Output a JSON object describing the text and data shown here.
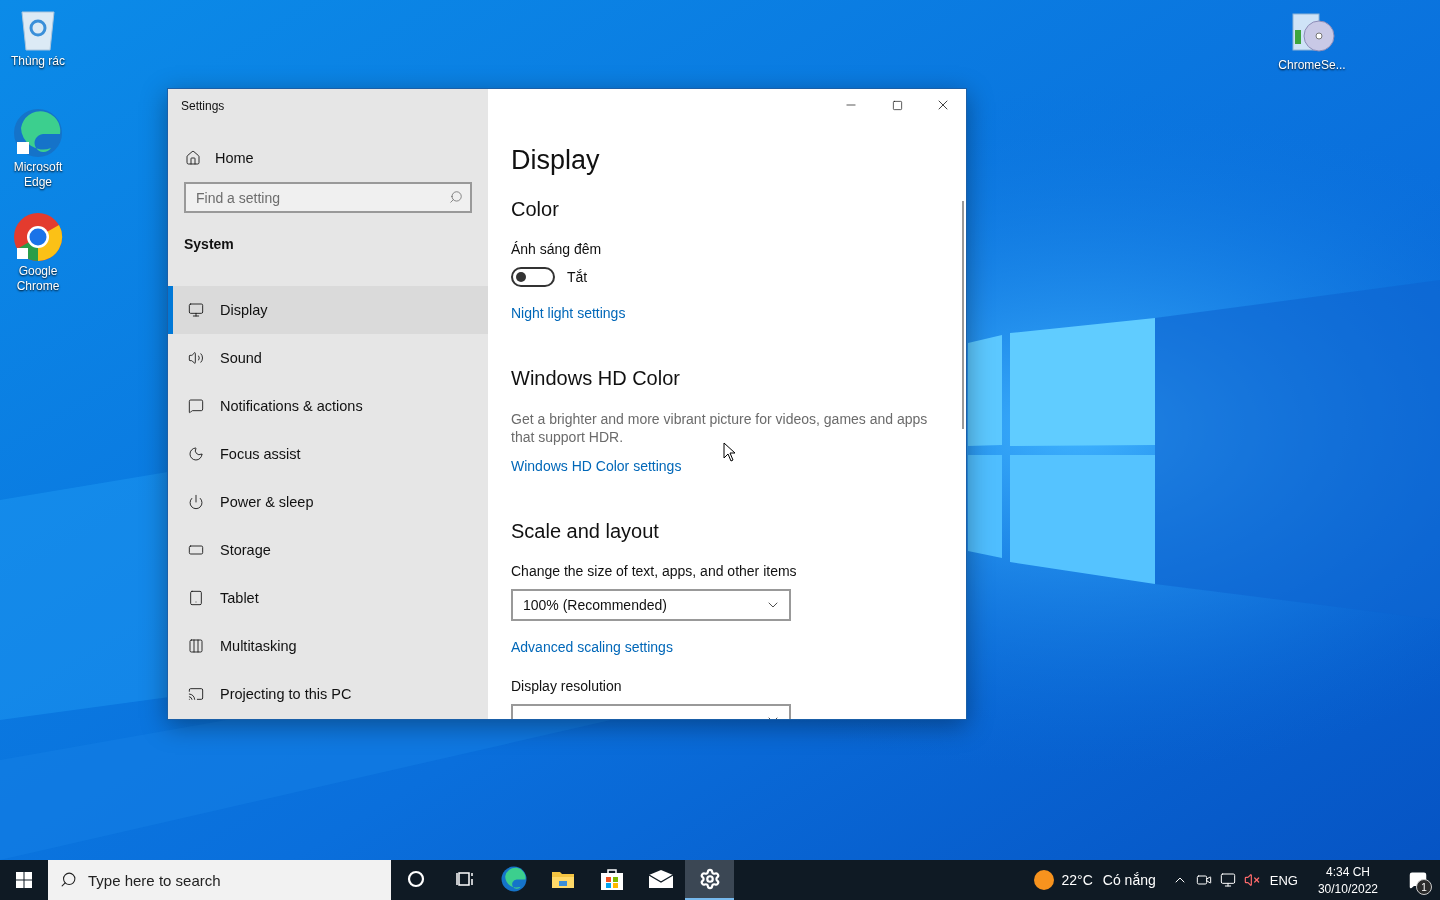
{
  "desktop_icons": [
    {
      "kind": "recycle-bin",
      "label": "Thùng rác"
    },
    {
      "kind": "edge",
      "label": "Microsoft Edge"
    },
    {
      "kind": "chrome",
      "label": "Google Chrome"
    },
    {
      "kind": "installer",
      "label": "ChromeSe..."
    }
  ],
  "window": {
    "title": "Settings",
    "sidebar": {
      "home": "Home",
      "search": {
        "placeholder": "Find a setting"
      },
      "section": "System",
      "items": [
        {
          "label": "Display",
          "selected": true
        },
        {
          "label": "Sound",
          "selected": false
        },
        {
          "label": "Notifications & actions",
          "selected": false
        },
        {
          "label": "Focus assist",
          "selected": false
        },
        {
          "label": "Power & sleep",
          "selected": false
        },
        {
          "label": "Storage",
          "selected": false
        },
        {
          "label": "Tablet",
          "selected": false
        },
        {
          "label": "Multitasking",
          "selected": false
        },
        {
          "label": "Projecting to this PC",
          "selected": false
        }
      ]
    },
    "content": {
      "title": "Display",
      "blocks": [
        {
          "kind": "heading",
          "text": "Color"
        },
        {
          "kind": "label",
          "text": "Ánh sáng đêm"
        },
        {
          "kind": "toggle",
          "on": false,
          "text": "Tắt"
        },
        {
          "kind": "link",
          "text": "Night light settings"
        },
        {
          "kind": "heading",
          "text": "Windows HD Color"
        },
        {
          "kind": "text",
          "text": "Get a brighter and more vibrant picture for videos, games and apps that support HDR."
        },
        {
          "kind": "link",
          "text": "Windows HD Color settings"
        },
        {
          "kind": "heading",
          "text": "Scale and layout"
        },
        {
          "kind": "label",
          "text": "Change the size of text, apps, and other items"
        },
        {
          "kind": "dropdown",
          "text": "100% (Recommended)"
        },
        {
          "kind": "link",
          "text": "Advanced scaling settings"
        },
        {
          "kind": "label",
          "text": "Display resolution"
        },
        {
          "kind": "dropdown"
        }
      ]
    }
  },
  "taskbar": {
    "search": {
      "placeholder": "Type here to search"
    },
    "apps": [
      {
        "kind": "cortana",
        "selected": false
      },
      {
        "kind": "task-view",
        "selected": false
      },
      {
        "kind": "edge",
        "selected": false
      },
      {
        "kind": "explorer",
        "selected": false
      },
      {
        "kind": "store",
        "selected": false
      },
      {
        "kind": "mail",
        "selected": false
      },
      {
        "kind": "settings",
        "selected": true
      }
    ],
    "weather": {
      "temperature": "22°C",
      "condition": "Có nắng"
    },
    "language": "ENG",
    "time": "4:34 CH",
    "date": "30/10/2022",
    "notifications": "1"
  }
}
